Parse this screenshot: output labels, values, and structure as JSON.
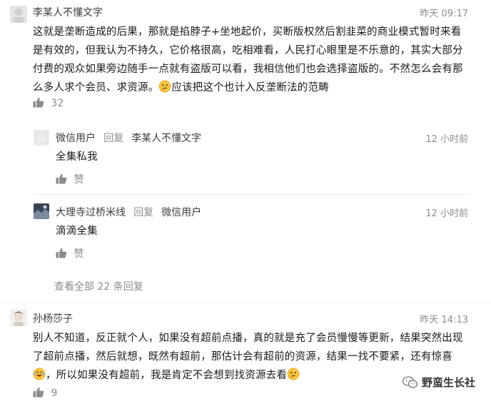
{
  "comments": [
    {
      "author": "李某人不懂文字",
      "time": "昨天 09:17",
      "text_lines": [
        "这就是垄断造成的后果，那就是掐脖子+坐地起价，买断版权然后割韭菜的商业模式暂时来看",
        "是有效的，但我认为不持久，它价格很高，吃相难看，人民打心眼里是不乐意的，其实大部分",
        "付费的观众如果旁边随手一点就有盗版可以看，我相信他们也会选择盗版的。不然怎么会有那",
        "么多人求个会员、求资源。",
        "应该把这个也计入反垄断法的范畴"
      ],
      "likes": "32",
      "replies": [
        {
          "author": "微信用户",
          "reply_word": "回复",
          "reply_to": "李某人不懂文字",
          "time": "12 小时前",
          "text": "全集私我",
          "like_label": "赞"
        },
        {
          "author": "大理寺过桥米线",
          "reply_word": "回复",
          "reply_to": "微信用户",
          "time": "12 小时前",
          "text": "滴滴全集",
          "like_label": "赞"
        }
      ],
      "view_all": "查看全部 22 条回复"
    },
    {
      "author": "孙杨莎子",
      "time": "昨天 14:13",
      "text_lines": [
        "别人不知道，反正就个人，如果没有超前点播，真的就是充了会员慢慢等更新，结果突然出现",
        "了超前点播，然后就想，既然有超前，那估计会有超前的资源，结果一找不要紧，还有惊喜",
        "，所以如果没有超前，我是肯定不会想到找资源去看"
      ],
      "likes": "9"
    }
  ],
  "watermark": {
    "brand": "野蛮生长社",
    "icon": "wechat-icon"
  },
  "colors": {
    "text": "#1a1a1a",
    "muted": "#8c8c8c",
    "divider": "#ededed",
    "emoji": "#f5c442"
  }
}
